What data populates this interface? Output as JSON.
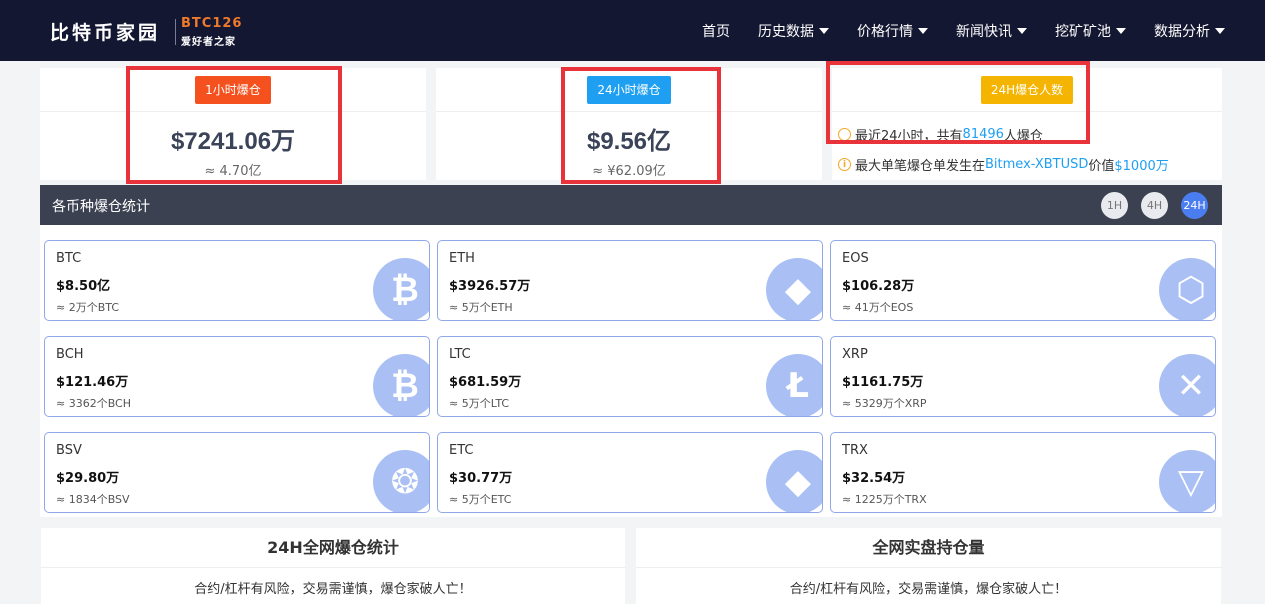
{
  "header": {
    "logo_main": "比特币家园",
    "logo_code": "BTC126",
    "logo_sub": "爱好者之家",
    "nav": [
      {
        "label": "首页",
        "dropdown": false
      },
      {
        "label": "历史数据",
        "dropdown": true
      },
      {
        "label": "价格行情",
        "dropdown": true
      },
      {
        "label": "新闻快讯",
        "dropdown": true
      },
      {
        "label": "挖矿矿池",
        "dropdown": true
      },
      {
        "label": "数据分析",
        "dropdown": true
      }
    ]
  },
  "stats": {
    "h1": {
      "tag": "1小时爆仓",
      "value": "$7241.06万",
      "sub": "≈ 4.70亿"
    },
    "h24": {
      "tag": "24小时爆仓",
      "value": "$9.56亿",
      "sub": "≈ ¥62.09亿"
    },
    "people": {
      "tag": "24H爆仓人数",
      "line1_pre": "最近24小时，共有",
      "line1_count": "81496",
      "line1_post": "人爆仓",
      "line2_pre": "最大单笔爆仓单发生在",
      "line2_exchange": "Bitmex-XBTUSD",
      "line2_mid": "价值",
      "line2_amount": "$1000万"
    }
  },
  "section": {
    "title": "各币种爆仓统计",
    "timeframes": [
      "1H",
      "4H",
      "24H"
    ],
    "active_timeframe": "24H"
  },
  "coins": [
    {
      "name": "BTC",
      "value": "$8.50亿",
      "sub": "≈ 2万个BTC",
      "icon": "bitcoin-icon",
      "glyph": "₿"
    },
    {
      "name": "ETH",
      "value": "$3926.57万",
      "sub": "≈ 5万个ETH",
      "icon": "ethereum-icon",
      "glyph": "◆"
    },
    {
      "name": "EOS",
      "value": "$106.28万",
      "sub": "≈ 41万个EOS",
      "icon": "eos-icon",
      "glyph": "⬡"
    },
    {
      "name": "BCH",
      "value": "$121.46万",
      "sub": "≈ 3362个BCH",
      "icon": "bitcoin-cash-icon",
      "glyph": "₿"
    },
    {
      "name": "LTC",
      "value": "$681.59万",
      "sub": "≈ 5万个LTC",
      "icon": "litecoin-icon",
      "glyph": "Ł"
    },
    {
      "name": "XRP",
      "value": "$1161.75万",
      "sub": "≈ 5329万个XRP",
      "icon": "ripple-icon",
      "glyph": "✕"
    },
    {
      "name": "BSV",
      "value": "$29.80万",
      "sub": "≈ 1834个BSV",
      "icon": "bitcoin-sv-icon",
      "glyph": "❂"
    },
    {
      "name": "ETC",
      "value": "$30.77万",
      "sub": "≈ 5万个ETC",
      "icon": "ethereum-classic-icon",
      "glyph": "◆"
    },
    {
      "name": "TRX",
      "value": "$32.54万",
      "sub": "≈ 1225万个TRX",
      "icon": "tron-icon",
      "glyph": "▽"
    }
  ],
  "panels": [
    {
      "title": "24H全网爆仓统计",
      "note": "合约/杠杆有风险，交易需谨慎，爆仓家破人亡！"
    },
    {
      "title": "全网实盘持仓量",
      "note": "合约/杠杆有风险，交易需谨慎，爆仓家破人亡！"
    }
  ],
  "colors": {
    "header_bg": "#141732",
    "accent_orange": "#f07a2c",
    "tag_red": "#f4511e",
    "tag_blue": "#1e9ff2",
    "tag_yellow": "#f5b400",
    "highlight_frame": "#e8333a",
    "card_border": "#8fa9e8",
    "icon_bg": "#aac0f4"
  }
}
